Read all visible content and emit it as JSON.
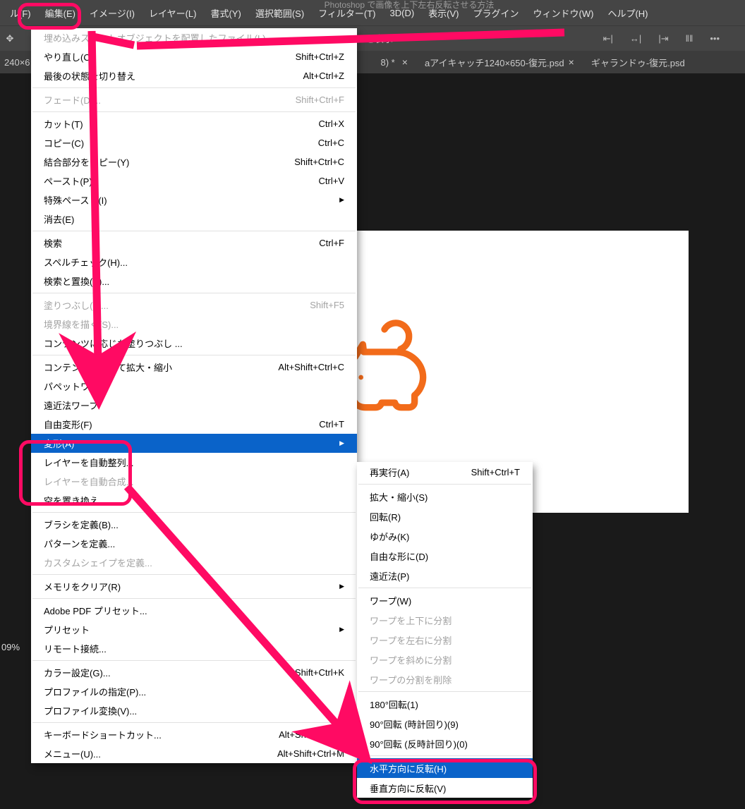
{
  "title_fragment": "Photoshop で画像を上下左右反転させる方法",
  "menubar": [
    "ル(F)",
    "編集(E)",
    "イメージ(I)",
    "レイヤー(L)",
    "書式(Y)",
    "選択範囲(S)",
    "フィルター(T)",
    "3D(D)",
    "表示(V)",
    "プラグイン",
    "ウィンドウ(W)",
    "ヘルプ(H)"
  ],
  "toolbar_label": "を表示",
  "tabs": {
    "partial1": "240×6…",
    "partial2": "8) *",
    "t2": "aアイキャッチ1240×650-復元.psd",
    "t3": "ギャランドゥ-復元.psd"
  },
  "zoom": "09%",
  "edit_menu": {
    "g1": [
      {
        "label": "埋め込みスマートオブジェクトを配置したファイル(L)",
        "sc": "",
        "disabled": true
      },
      {
        "label": "やり直し(O)",
        "sc": "Shift+Ctrl+Z"
      },
      {
        "label": "最後の状態を切り替え",
        "sc": "Alt+Ctrl+Z"
      }
    ],
    "g2": [
      {
        "label": "フェード(D)...",
        "sc": "Shift+Ctrl+F",
        "disabled": true
      }
    ],
    "g3": [
      {
        "label": "カット(T)",
        "sc": "Ctrl+X"
      },
      {
        "label": "コピー(C)",
        "sc": "Ctrl+C"
      },
      {
        "label": "結合部分をコピー(Y)",
        "sc": "Shift+Ctrl+C"
      },
      {
        "label": "ペースト(P)",
        "sc": "Ctrl+V"
      },
      {
        "label": "特殊ペースト(I)",
        "sc": "",
        "arrow": true
      },
      {
        "label": "消去(E)",
        "sc": ""
      }
    ],
    "g4": [
      {
        "label": "検索",
        "sc": "Ctrl+F"
      },
      {
        "label": "スペルチェック(H)..."
      },
      {
        "label": "検索と置換(X)..."
      }
    ],
    "g5": [
      {
        "label": "塗りつぶし(L)...",
        "sc": "Shift+F5",
        "disabled": true
      },
      {
        "label": "境界線を描く(S)...",
        "disabled": true
      },
      {
        "label": "コンテンツに応じた塗りつぶし ..."
      }
    ],
    "g6": [
      {
        "label": "コンテンツに応じて拡大・縮小",
        "sc": "Alt+Shift+Ctrl+C"
      },
      {
        "label": "パペットワープ"
      },
      {
        "label": "遠近法ワープ"
      },
      {
        "label": "自由変形(F)",
        "sc": "Ctrl+T"
      },
      {
        "label": "変形(A)",
        "sc": "",
        "arrow": true,
        "sel": true
      },
      {
        "label": "レイヤーを自動整列..."
      },
      {
        "label": "レイヤーを自動合成...",
        "disabled": true
      },
      {
        "label": "空を置き換え..."
      }
    ],
    "g7": [
      {
        "label": "ブラシを定義(B)..."
      },
      {
        "label": "パターンを定義..."
      },
      {
        "label": "カスタムシェイプを定義...",
        "disabled": true
      }
    ],
    "g8": [
      {
        "label": "メモリをクリア(R)",
        "sc": "",
        "arrow": true
      }
    ],
    "g9": [
      {
        "label": "Adobe PDF プリセット..."
      },
      {
        "label": "プリセット",
        "arrow": true
      },
      {
        "label": "リモート接続..."
      }
    ],
    "g10": [
      {
        "label": "カラー設定(G)...",
        "sc": "Shift+Ctrl+K"
      },
      {
        "label": "プロファイルの指定(P)..."
      },
      {
        "label": "プロファイル変換(V)..."
      }
    ],
    "g11": [
      {
        "label": "キーボードショートカット...",
        "sc": "Alt+Shift+Ctrl+K"
      },
      {
        "label": "メニュー(U)...",
        "sc": "Alt+Shift+Ctrl+M"
      }
    ]
  },
  "transform_submenu": {
    "g1": [
      {
        "label": "再実行(A)",
        "sc": "Shift+Ctrl+T"
      }
    ],
    "g2": [
      {
        "label": "拡大・縮小(S)"
      },
      {
        "label": "回転(R)"
      },
      {
        "label": "ゆがみ(K)"
      },
      {
        "label": "自由な形に(D)"
      },
      {
        "label": "遠近法(P)"
      }
    ],
    "g3": [
      {
        "label": "ワープ(W)"
      },
      {
        "label": "ワープを上下に分割",
        "disabled": true
      },
      {
        "label": "ワープを左右に分割",
        "disabled": true
      },
      {
        "label": "ワープを斜めに分割",
        "disabled": true
      },
      {
        "label": "ワープの分割を削除",
        "disabled": true
      }
    ],
    "g4": [
      {
        "label": "180°回転(1)"
      },
      {
        "label": "90°回転 (時計回り)(9)"
      },
      {
        "label": "90°回転 (反時計回り)(0)"
      }
    ],
    "g5": [
      {
        "label": "水平方向に反転(H)",
        "sel": true
      },
      {
        "label": "垂直方向に反転(V)"
      }
    ]
  }
}
